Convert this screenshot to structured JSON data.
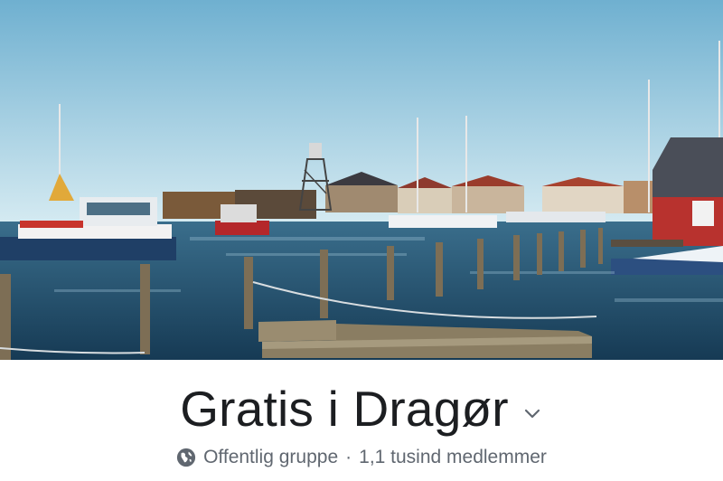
{
  "cover_photo": {
    "kind": "harbor-photo",
    "colors": {
      "sky_top": "#7ab6d4",
      "sky_bottom": "#cfe6f0",
      "water": "#1f4f6e",
      "house_red": "#b8322e",
      "dock_wood": "#8a7d62"
    }
  },
  "group": {
    "name": "Gratis i Dragør",
    "privacy": "Offentlig gruppe",
    "separator": "·",
    "members": "1,1 tusind medlemmer"
  },
  "icons": {
    "privacy": "globe-icon",
    "menu": "chevron-down-icon"
  },
  "colors": {
    "title": "#1c1e21",
    "meta": "#606770"
  }
}
